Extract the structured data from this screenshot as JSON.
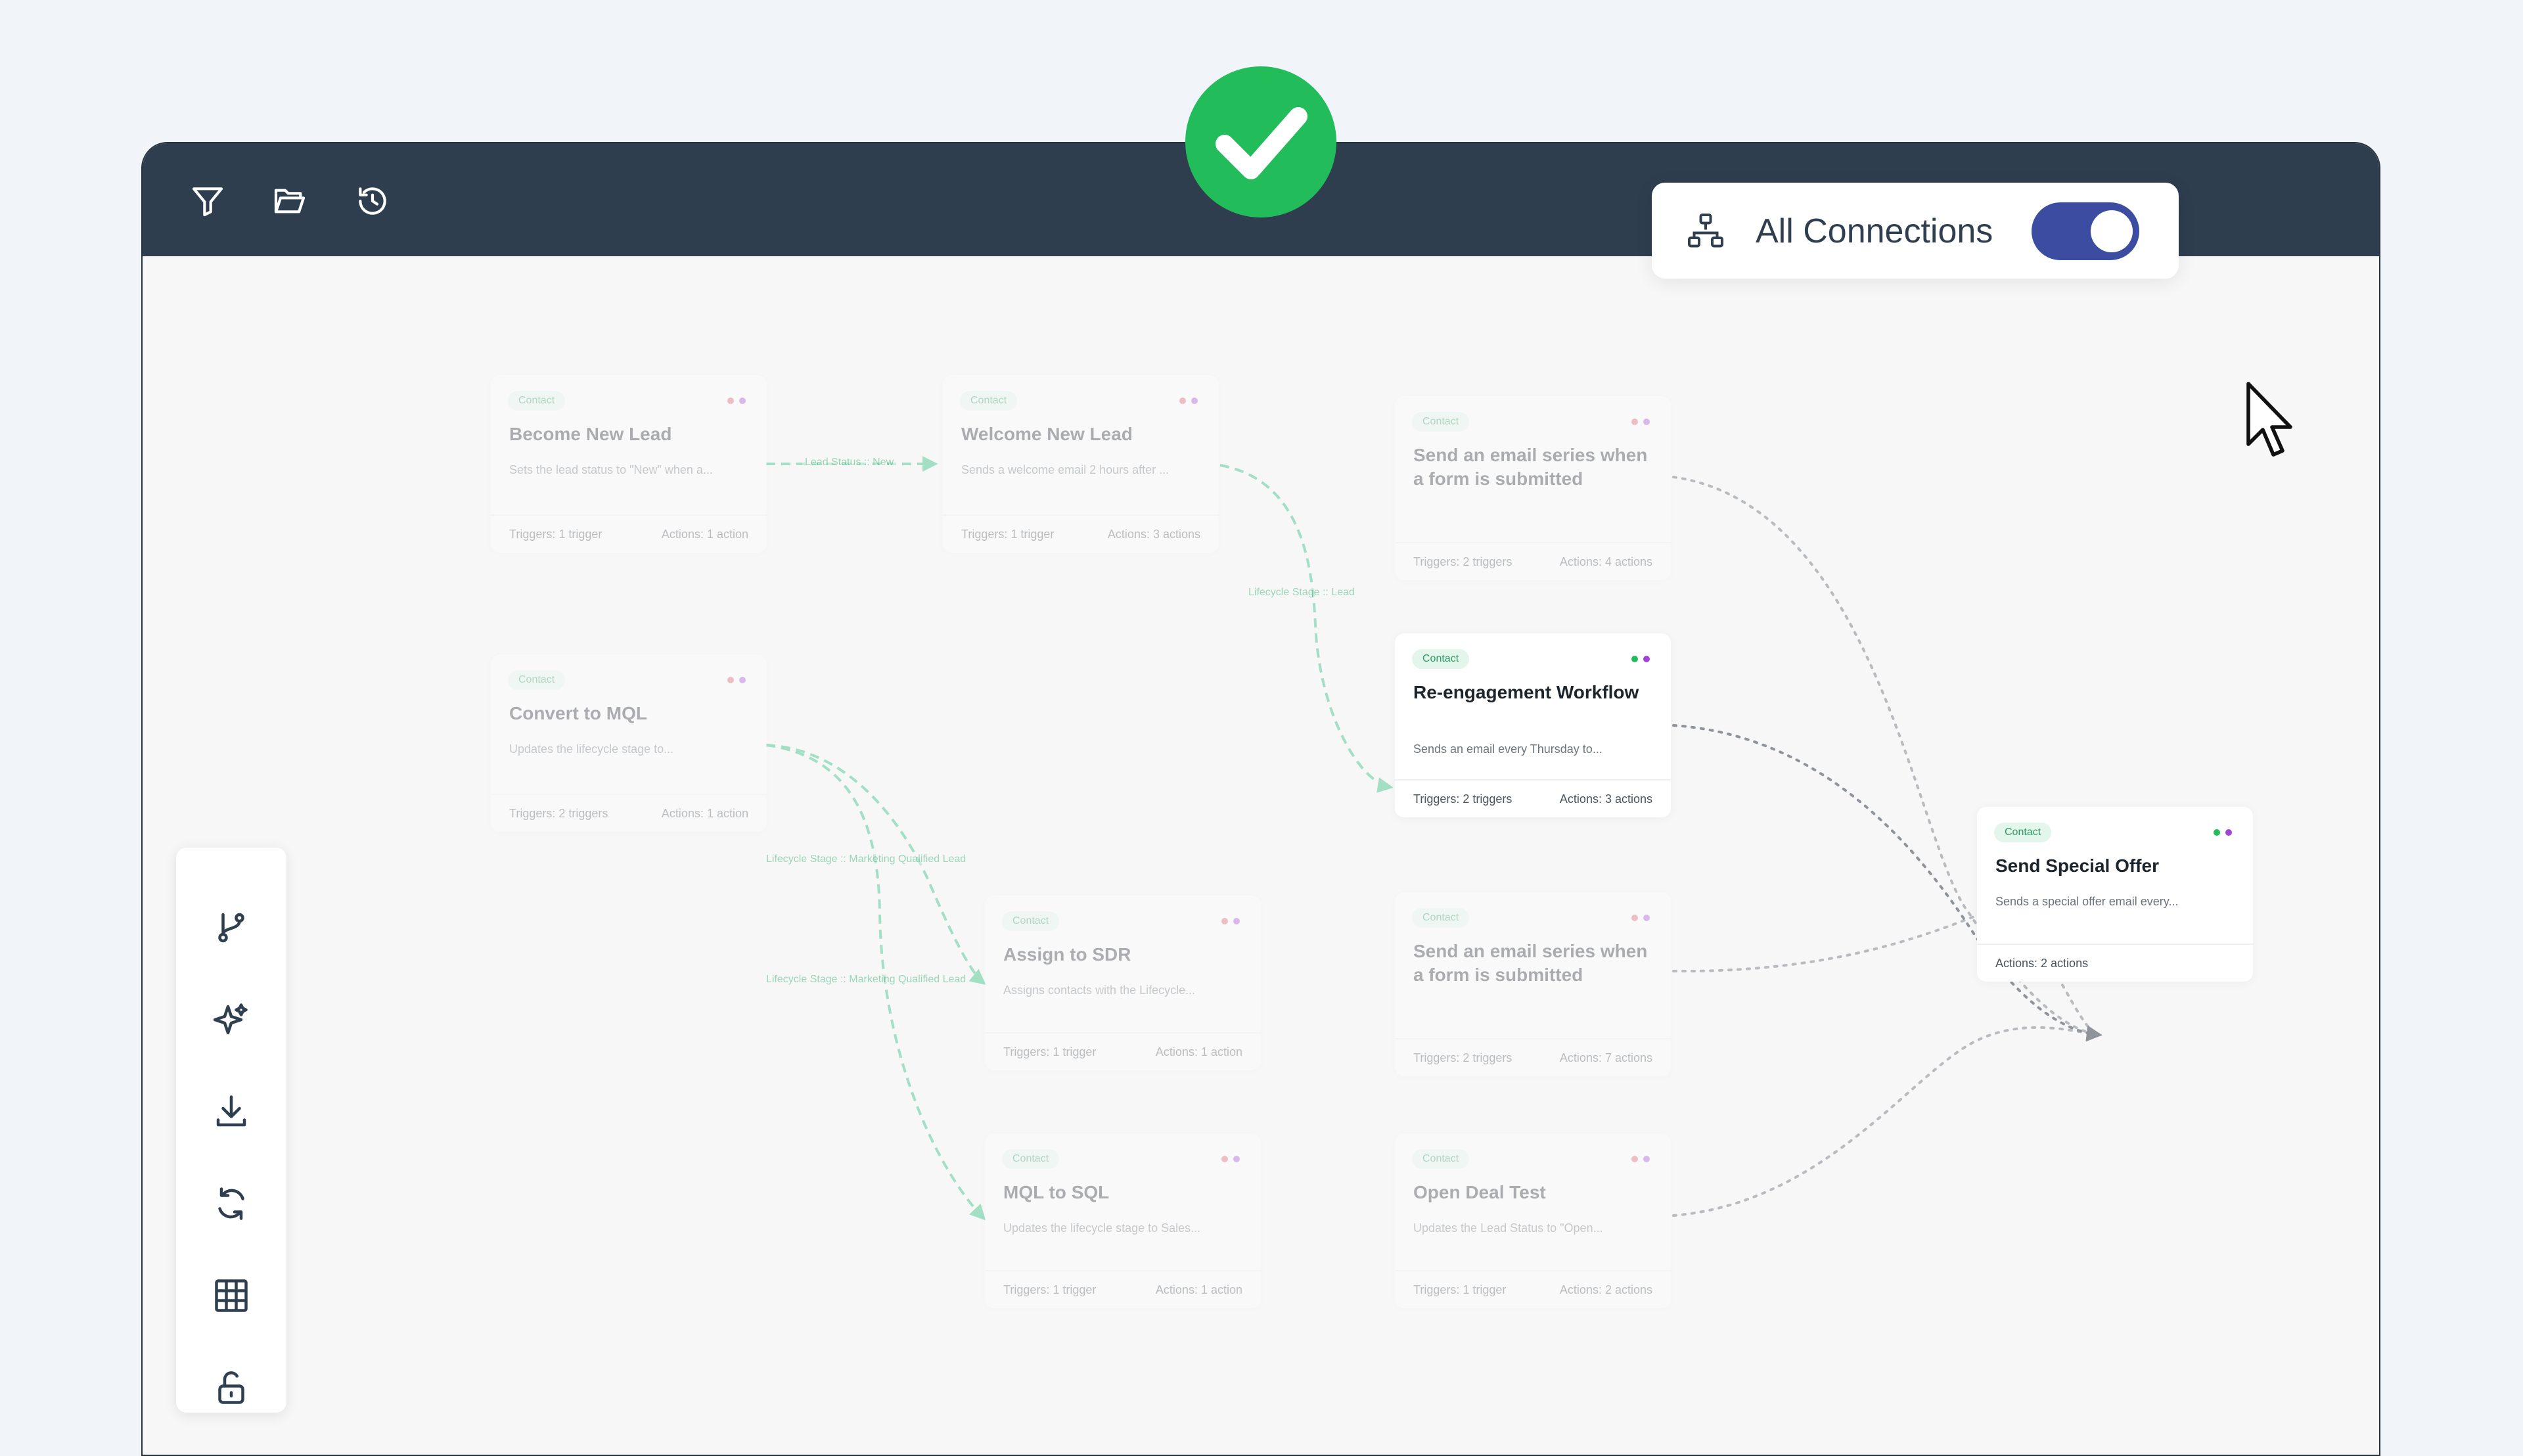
{
  "topbar": {
    "icons": [
      "filter-icon",
      "folder-open-icon",
      "history-icon"
    ]
  },
  "status_badge": {
    "icon": "check-icon",
    "color": "#22bd5a"
  },
  "connections_toggle": {
    "label": "All Connections",
    "icon": "org-chart-icon",
    "enabled": true,
    "color": "#3c4ca0"
  },
  "toolbar": {
    "icons": [
      "branch-icon",
      "sparkle-icon",
      "download-icon",
      "refresh-icon",
      "grid-icon",
      "unlock-icon"
    ]
  },
  "edge_labels": {
    "lead_status": "Lead Status :: New",
    "lifecycle_lead": "Lifecycle Stage :: Lead",
    "lifecycle_mql_1": "Lifecycle Stage :: Marketing Qualified Lead",
    "lifecycle_mql_2": "Lifecycle Stage :: Marketing Qualified Lead"
  },
  "nodes": {
    "become_new_lead": {
      "tag": "Contact",
      "title": "Become New Lead",
      "desc": "Sets the lead status to \"New\" when a...",
      "triggers": "Triggers: 1 trigger",
      "actions": "Actions: 1 action"
    },
    "welcome_new_lead": {
      "tag": "Contact",
      "title": "Welcome New Lead",
      "desc": "Sends a welcome email 2 hours after ...",
      "triggers": "Triggers: 1 trigger",
      "actions": "Actions: 3 actions"
    },
    "email_series_1": {
      "tag": "Contact",
      "title": "Send an email series when a form is submitted",
      "triggers": "Triggers: 2 triggers",
      "actions": "Actions: 4 actions"
    },
    "convert_mql": {
      "tag": "Contact",
      "title": "Convert to MQL",
      "desc": "Updates the lifecycle stage to...",
      "triggers": "Triggers: 2 triggers",
      "actions": "Actions: 1 action"
    },
    "reengagement": {
      "tag": "Contact",
      "title": "Re-engagement Workflow",
      "desc": "Sends an email every Thursday to...",
      "triggers": "Triggers: 2 triggers",
      "actions": "Actions: 3 actions"
    },
    "assign_sdr": {
      "tag": "Contact",
      "title": "Assign to SDR",
      "desc": "Assigns contacts with the Lifecycle...",
      "triggers": "Triggers: 1 trigger",
      "actions": "Actions: 1 action"
    },
    "email_series_2": {
      "tag": "Contact",
      "title": "Send an email series when a form is submitted",
      "triggers": "Triggers: 2 triggers",
      "actions": "Actions: 7 actions"
    },
    "mql_sql": {
      "tag": "Contact",
      "title": "MQL to SQL",
      "desc": "Updates the lifecycle stage to Sales...",
      "triggers": "Triggers: 1 trigger",
      "actions": "Actions: 1 action"
    },
    "open_deal": {
      "tag": "Contact",
      "title": "Open Deal Test",
      "desc": "Updates the Lead Status to \"Open...",
      "triggers": "Triggers: 1 trigger",
      "actions": "Actions: 2 actions"
    },
    "special_offer": {
      "tag": "Contact",
      "title": "Send Special Offer",
      "desc": "Sends a special offer email every...",
      "actions": "Actions: 2 actions"
    }
  },
  "colors": {
    "topbar": "#2e3e4f",
    "canvas": "#f7f7f7",
    "edge_active": "#3cc48a",
    "edge_dotted": "#8f949b",
    "tag_bg": "#e3f6ec",
    "tag_text": "#2f9a63",
    "dot_green": "#22bd5a",
    "dot_purple": "#a245d6",
    "dot_red": "#e0556a"
  }
}
